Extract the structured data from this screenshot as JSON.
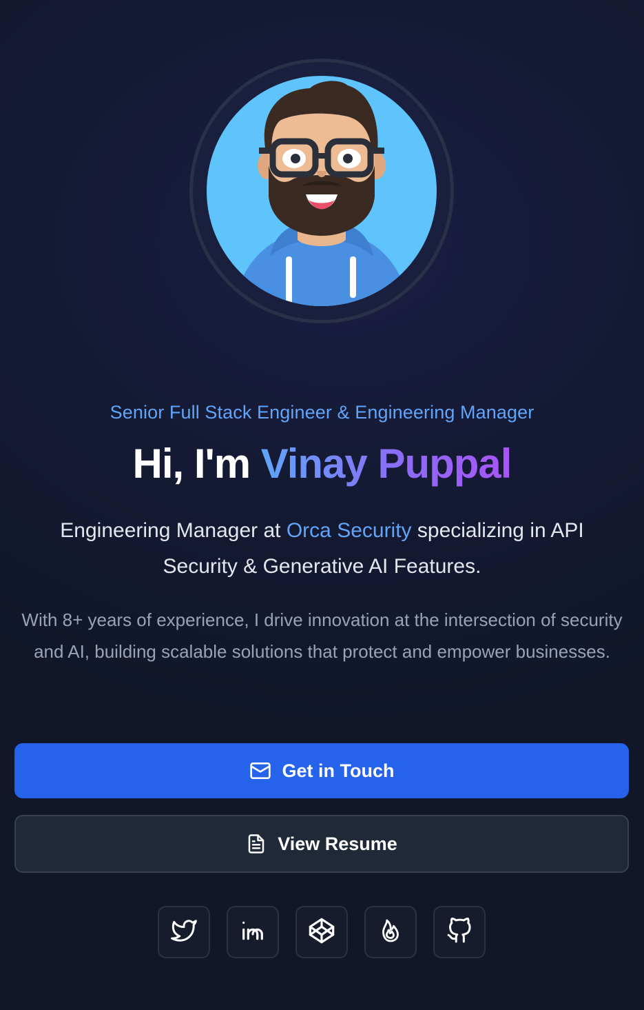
{
  "hero": {
    "subtitle": "Senior Full Stack Engineer & Engineering Manager",
    "greeting": "Hi, I'm ",
    "name": "Vinay Puppal",
    "role_prefix": "Engineering Manager at ",
    "company": "Orca Security",
    "role_suffix": " specializing in API Security & Generative AI Features.",
    "bio": "With 8+ years of experience, I drive innovation at the intersection of security and AI, building scalable solutions that protect and empower businesses."
  },
  "buttons": {
    "contact_label": "Get in Touch",
    "contact_icon": "mail-icon",
    "resume_label": "View Resume",
    "resume_icon": "file-text-icon"
  },
  "social": [
    {
      "name": "twitter",
      "icon": "twitter-icon"
    },
    {
      "name": "linkedin",
      "icon": "linkedin-icon"
    },
    {
      "name": "codepen",
      "icon": "codepen-icon"
    },
    {
      "name": "flame",
      "icon": "flame-icon"
    },
    {
      "name": "github",
      "icon": "github-icon"
    }
  ],
  "colors": {
    "background": "#151a35",
    "accent_blue": "#60a5fa",
    "accent_purple": "#a855f7",
    "primary_button": "#2563eb",
    "secondary_button": "#1f2937"
  }
}
